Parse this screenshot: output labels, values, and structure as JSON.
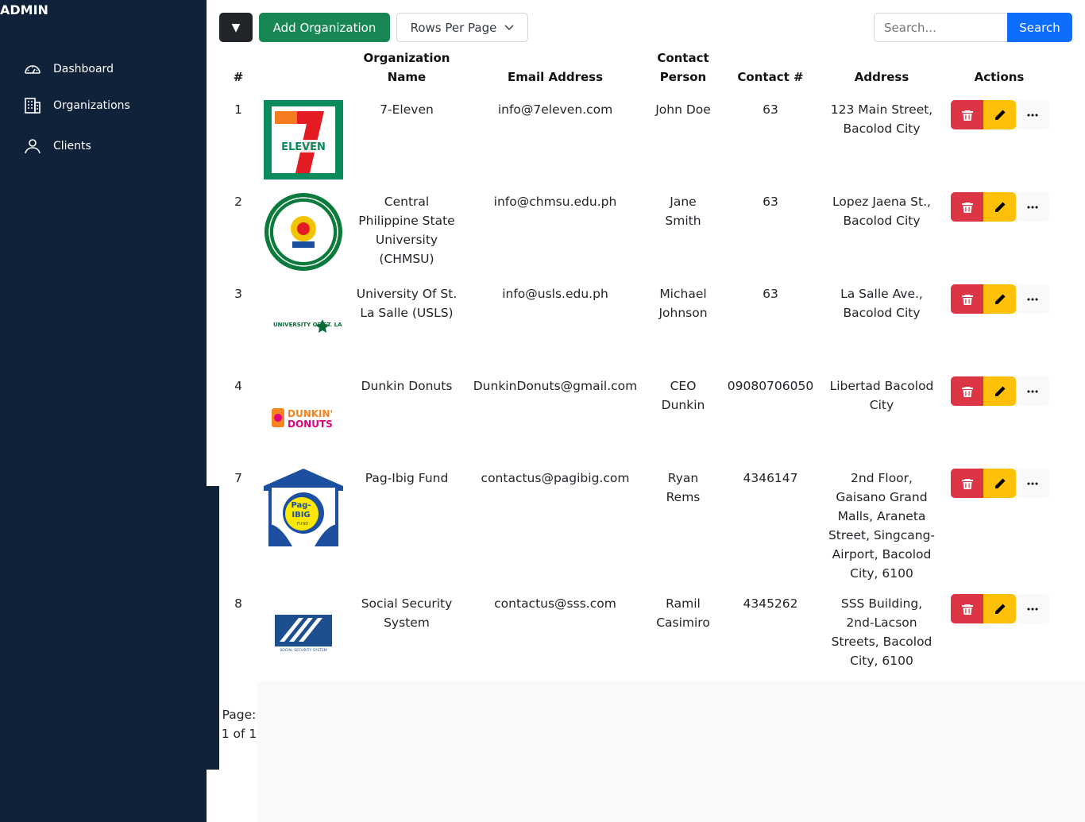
{
  "brand": "ADMIN",
  "sidebar": {
    "items": [
      {
        "label": "Dashboard",
        "icon": "gauge-icon"
      },
      {
        "label": "Organizations",
        "icon": "building-icon"
      },
      {
        "label": "Clients",
        "icon": "user-icon"
      }
    ]
  },
  "toolbar": {
    "filter_label": "▼",
    "add_label": "Add Organization",
    "rows_label": "Rows Per Page",
    "search_placeholder": "Search...",
    "search_label": "Search"
  },
  "table": {
    "headers": {
      "index": "#",
      "name_line1": "Organization",
      "name_line2": "Name",
      "email": "Email Address",
      "contact_line1": "Contact",
      "contact_line2": "Person",
      "phone": "Contact #",
      "address": "Address",
      "actions": "Actions"
    },
    "rows": [
      {
        "index": "1",
        "name": [
          "7-Eleven"
        ],
        "email": "info@7eleven.com",
        "contact": [
          "John Doe"
        ],
        "phone": "63",
        "address": [
          "123 Main Street,",
          "Bacolod City"
        ]
      },
      {
        "index": "2",
        "name": [
          "Central",
          "Philippine State",
          "University",
          "(CHMSU)"
        ],
        "email": "info@chmsu.edu.ph",
        "contact": [
          "Jane",
          "Smith"
        ],
        "phone": "63",
        "address": [
          "Lopez Jaena St.,",
          "Bacolod City"
        ]
      },
      {
        "index": "3",
        "name": [
          "University Of St.",
          "La Salle (USLS)"
        ],
        "email": "info@usls.edu.ph",
        "contact": [
          "Michael",
          "Johnson"
        ],
        "phone": "63",
        "address": [
          "La Salle Ave.,",
          "Bacolod City"
        ]
      },
      {
        "index": "4",
        "name": [
          "Dunkin Donuts"
        ],
        "email": "DunkinDonuts@gmail.com",
        "contact": [
          "CEO",
          "Dunkin"
        ],
        "phone": "09080706050",
        "address": [
          "Libertad Bacolod",
          "City"
        ]
      },
      {
        "index": "7",
        "name": [
          "Pag-Ibig Fund"
        ],
        "email": "contactus@pagibig.com",
        "contact": [
          "Ryan",
          "Rems"
        ],
        "phone": "4346147",
        "address": [
          "2nd Floor,",
          "Gaisano Grand",
          "Malls, Araneta",
          "Street, Singcang-",
          "Airport, Bacolod",
          "City, 6100"
        ]
      },
      {
        "index": "8",
        "name": [
          "Social Security",
          "System"
        ],
        "email": "contactus@sss.com",
        "contact": [
          "Ramil",
          "Casimiro"
        ],
        "phone": "4345262",
        "address": [
          "SSS Building,",
          "2nd-Lacson",
          "Streets, Bacolod",
          "City, 6100"
        ]
      }
    ]
  },
  "logos": {
    "seven_eleven": "ELEVEN",
    "usls": "UNIVERSITY OF ST. LA SALLE",
    "dunkin": [
      "DUNKIN'",
      "DONUTS"
    ],
    "pagibig": [
      "Pag-",
      "IBIG",
      "FUND"
    ],
    "sss": "SOCIAL SECURITY SYSTEM"
  },
  "pager": {
    "label": "Page:",
    "value": "1 of 1"
  },
  "colors": {
    "sidebar": "#0f2239",
    "add": "#198754",
    "search": "#0d6efd",
    "delete": "#dc3545",
    "edit": "#ffc107"
  }
}
